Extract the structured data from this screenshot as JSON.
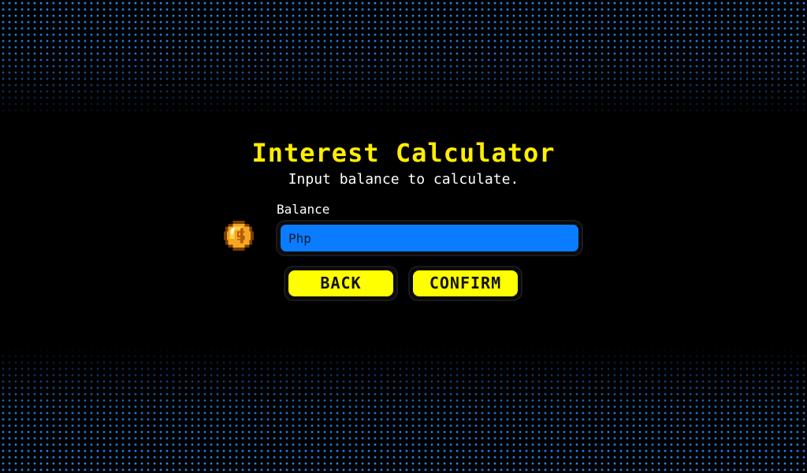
{
  "calculator": {
    "title": "Interest Calculator",
    "subtitle": "Input balance to calculate.",
    "balance_label": "Balance",
    "balance_placeholder": "Php",
    "balance_value": "",
    "coin_icon": "coin-icon",
    "back_label": "BACK",
    "confirm_label": "CONFIRM"
  },
  "colors": {
    "background": "#000000",
    "accent_yellow": "#ffff00",
    "title_yellow": "#ffee00",
    "input_blue": "#0a7cff",
    "dot_blue": "#1e88ff",
    "coin_gold": "#f5a623"
  }
}
